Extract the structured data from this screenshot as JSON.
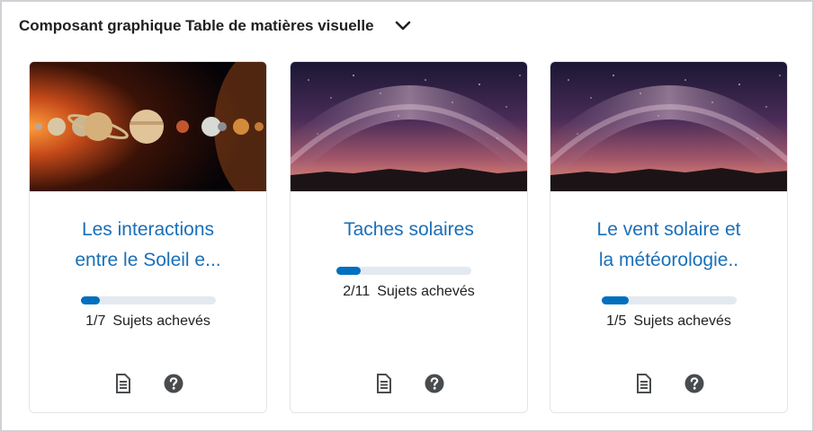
{
  "widget": {
    "title": "Composant graphique Table de matières visuelle",
    "collapse_icon": "chevron-down-icon"
  },
  "cards": [
    {
      "title_line1": "Les interactions",
      "title_line2": "entre le Soleil e...",
      "progress_fraction": 0.1429,
      "progress_count": "1/7",
      "progress_label": "Sujets achevés",
      "image": "planets-image",
      "icons": [
        "document-icon",
        "help-circle-icon"
      ]
    },
    {
      "title_line1": "Taches solaires",
      "progress_fraction": 0.1818,
      "progress_count": "2/11",
      "progress_label": "Sujets achevés",
      "image": "milky-way-image",
      "icons": [
        "document-icon",
        "help-circle-icon"
      ]
    },
    {
      "title_line1": "Le vent solaire et",
      "title_line2": "la météorologie..",
      "progress_fraction": 0.2,
      "progress_count": "1/5",
      "progress_label": "Sujets achevés",
      "image": "milky-way-image",
      "icons": [
        "document-icon",
        "help-circle-icon"
      ]
    }
  ],
  "colors": {
    "accent": "#006fbf",
    "link": "#1a6fb9",
    "track": "#e3e9f0",
    "border": "#cfd1d4"
  }
}
